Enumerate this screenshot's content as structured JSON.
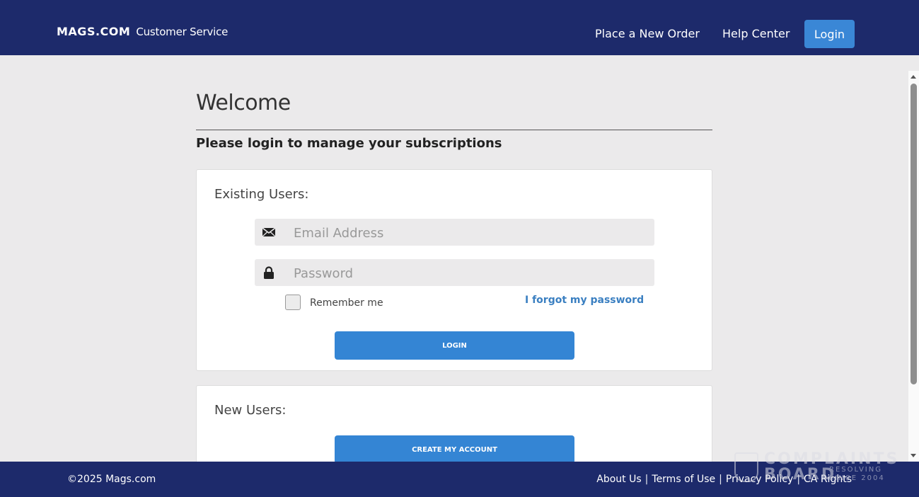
{
  "header": {
    "logo": "MAGS.COM",
    "logo_sub": "Customer Service",
    "nav": {
      "place_order": "Place a New Order",
      "help_center": "Help Center",
      "login": "Login"
    }
  },
  "main": {
    "welcome": "Welcome",
    "subtitle": "Please login to manage your subscriptions",
    "existing": {
      "title": "Existing Users:",
      "email_placeholder": "Email Address",
      "email_value": "",
      "password_placeholder": "Password",
      "password_value": "",
      "remember_label": "Remember me",
      "remember_checked": false,
      "forgot_link": "I forgot my password",
      "login_button": "LOGIN"
    },
    "new_users": {
      "title": "New Users:",
      "create_button": "CREATE MY ACCOUNT"
    }
  },
  "footer": {
    "copyright": "©2025 Mags.com",
    "links": [
      "About Us",
      "Terms of Use",
      "Privacy Policy",
      "CA Rights"
    ],
    "separator": "|"
  },
  "watermark": {
    "line1": "COMPLAINTS",
    "line2": "BOARD",
    "line3": "RESOLVING SINCE 2004"
  },
  "icons": {
    "email": "envelope-icon",
    "password": "lock-icon"
  },
  "colors": {
    "header_bg": "#1d2a6b",
    "accent": "#3a87d6",
    "link": "#3a7fc1",
    "page_bg": "#ebeaeb"
  }
}
